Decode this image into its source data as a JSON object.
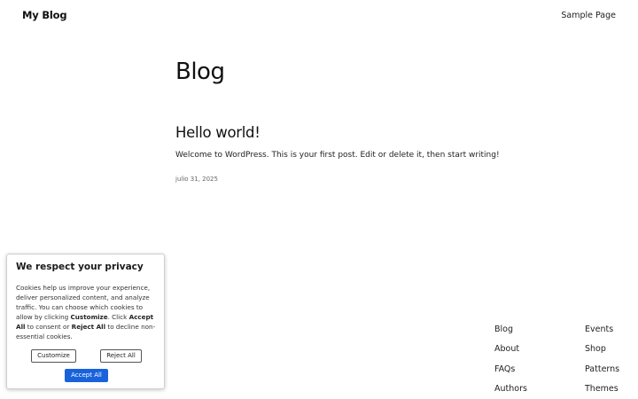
{
  "header": {
    "site_title": "My Blog",
    "nav": [
      "Sample Page"
    ]
  },
  "main": {
    "heading": "Blog",
    "posts": [
      {
        "title": "Hello world!",
        "excerpt": "Welcome to WordPress. This is your first post. Edit or delete it, then start writing!",
        "date": "julio 31, 2025"
      }
    ]
  },
  "footer": {
    "col1": [
      "Blog",
      "About",
      "FAQs",
      "Authors"
    ],
    "col2": [
      "Events",
      "Shop",
      "Patterns",
      "Themes"
    ]
  },
  "cookie_banner": {
    "title": "We respect your privacy",
    "text_1": "Cookies help us improve your experience, deliver personalized content, and analyze traffic. You can choose which cookies to allow by clicking ",
    "text_customize": "Customize",
    "text_2": ". Click ",
    "text_accept": "Accept All",
    "text_3": " to consent or ",
    "text_reject": "Reject All",
    "text_4": " to decline non-essential cookies.",
    "customize_label": "Customize",
    "reject_label": "Reject All",
    "accept_label": "Accept All",
    "accept_color": "#1863dc"
  }
}
